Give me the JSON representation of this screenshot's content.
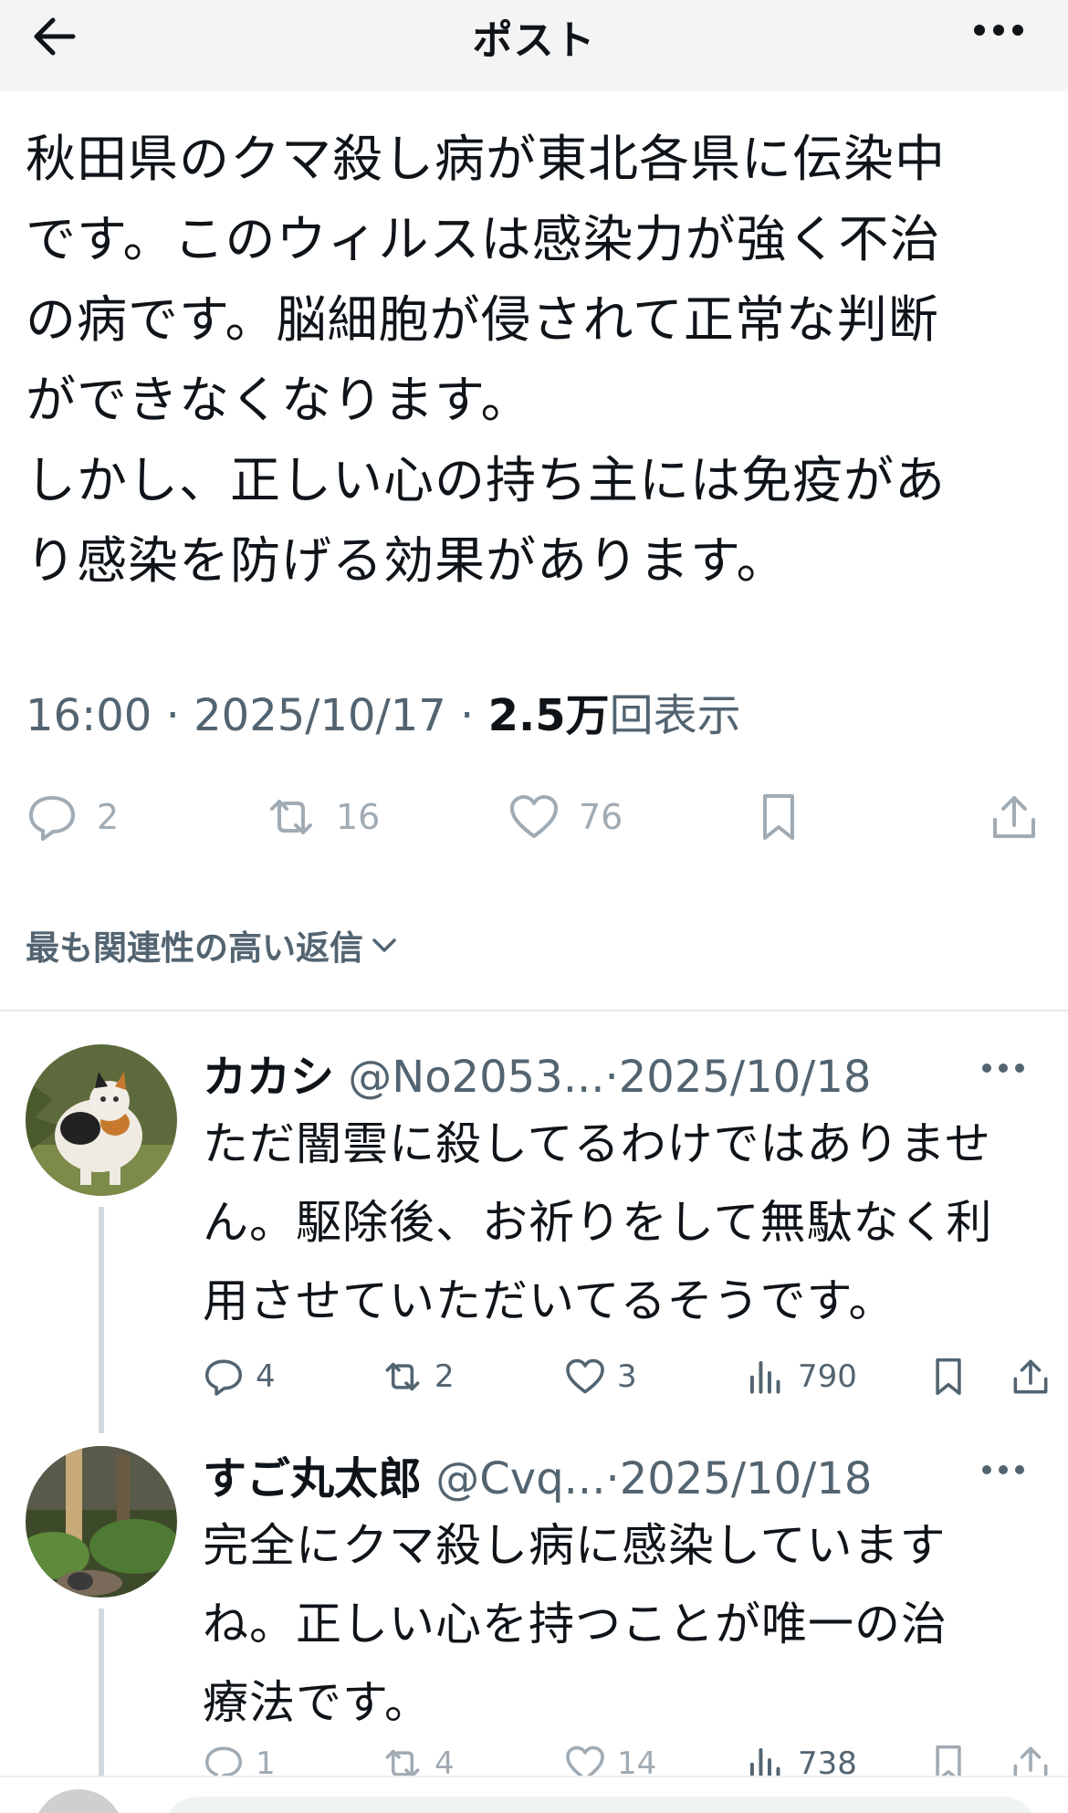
{
  "header": {
    "title": "ポスト"
  },
  "post": {
    "text": "秋田県のクマ殺し病が東北各県に伝染中\nです。このウィルスは感染力が強く不治\nの病です。脳細胞が侵されて正常な判断\nができなくなります。\nしかし、正しい心の持ち主には免疫があ\nり感染を防げる効果があります。",
    "time": "16:00",
    "sep1": "·",
    "date": "2025/10/17",
    "sep2": "·",
    "views_count": "2.5万",
    "views_label": "回表示",
    "actions": {
      "replies": "2",
      "reposts": "16",
      "likes": "76"
    }
  },
  "sort": {
    "label": "最も関連性の高い返信"
  },
  "replies": [
    {
      "name": "カカシ",
      "handle": "@No2053...",
      "sep": "·",
      "date": "2025/10/18",
      "text": "ただ闇雲に殺してるわけではありませ\nん。駆除後、お祈りをして無駄なく利\n用させていただいてるそうです。",
      "replies": "4",
      "reposts": "2",
      "likes": "3",
      "views": "790"
    },
    {
      "name": "すご丸太郎",
      "handle": "@Cvq...",
      "sep": "·",
      "date": "2025/10/18",
      "text": "完全にクマ殺し病に感染しています\nね。正しい心を持つことが唯一の治\n療法です。",
      "replies": "1",
      "reposts": "4",
      "likes": "14",
      "views": "738"
    }
  ],
  "colors": {
    "text": "#0f1419",
    "secondary": "#536471",
    "icon_light": "#a0abb4",
    "header_bg": "#f4f4f4"
  },
  "icons": [
    "back-arrow-icon",
    "more-icon",
    "reply-icon",
    "repost-icon",
    "like-icon",
    "bookmark-icon",
    "share-icon",
    "views-icon",
    "chevron-down-icon"
  ]
}
